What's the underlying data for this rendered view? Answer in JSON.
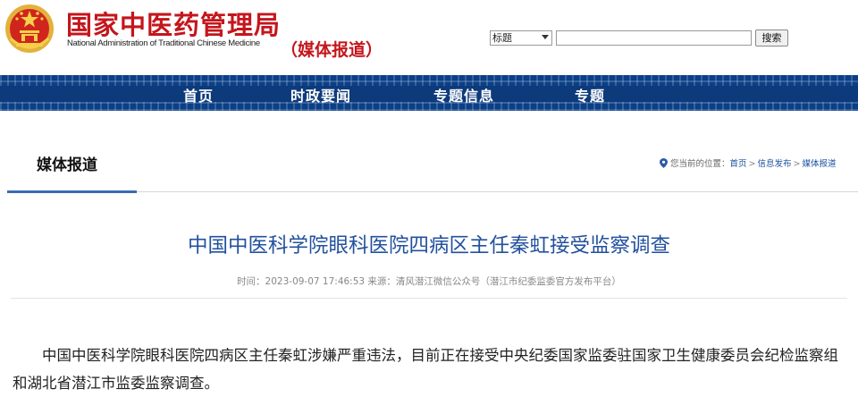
{
  "header": {
    "site_title": "国家中医药管理局",
    "site_subtitle": "National Administration of Traditional Chinese Medicine",
    "section_tag": "（媒体报道）",
    "emblem_icon": "national-emblem-icon"
  },
  "search": {
    "select_value": "标题",
    "input_value": "",
    "button_label": "搜索"
  },
  "nav": {
    "items": [
      {
        "label": "首页"
      },
      {
        "label": "时政要闻"
      },
      {
        "label": "专题信息"
      },
      {
        "label": "专题"
      }
    ]
  },
  "page_head": {
    "title": "媒体报道",
    "breadcrumb_prefix": "您当前的位置：",
    "crumbs": [
      "首页",
      "信息发布",
      "媒体报道"
    ],
    "separator": ">"
  },
  "article": {
    "title": "中国中医科学院眼科医院四病区主任秦虹接受监察调查",
    "meta": "时间：2023-09-07 17:46:53 来源：清风潜江微信公众号（潜江市纪委监委官方发布平台）",
    "body": "中国中医科学院眼科医院四病区主任秦虹涉嫌严重违法，目前正在接受中央纪委国家监委驻国家卫生健康委员会纪检监察组和湖北省潜江市监委监察调查。"
  },
  "colors": {
    "brand_red": "#c4161c",
    "nav_blue": "#0b3f87",
    "title_blue": "#23519e"
  }
}
